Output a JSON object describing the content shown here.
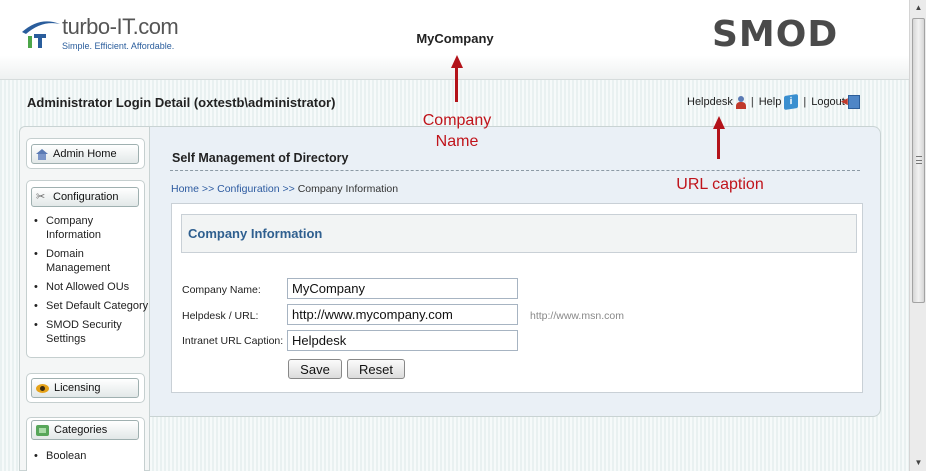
{
  "header": {
    "brand_name": "turbo-IT.com",
    "brand_tagline": "Simple. Efficient. Affordable.",
    "company_title": "MyCompany",
    "right_logo": "SMOD"
  },
  "subheader": {
    "admin_title": "Administrator Login Detail (oxtestb\\administrator)",
    "links": {
      "helpdesk": "Helpdesk",
      "help": "Help",
      "logout": "Logout",
      "separator": "|"
    }
  },
  "sidebar": {
    "admin_home": "Admin Home",
    "configuration": {
      "label": "Configuration",
      "items": [
        "Company Information",
        "Domain Management",
        "Not Allowed OUs",
        "Set Default Category",
        "SMOD Security Settings"
      ]
    },
    "licensing": "Licensing",
    "categories": {
      "label": "Categories",
      "items": [
        "Boolean"
      ]
    }
  },
  "main": {
    "title": "Self Management of Directory",
    "breadcrumb": {
      "home": "Home",
      "sep": " >> ",
      "configuration": "Configuration",
      "current": "Company Information"
    },
    "section_title": "Company Information",
    "form": {
      "company_name_label": "Company Name:",
      "company_name_value": "MyCompany",
      "helpdesk_url_label": "Helpdesk / URL:",
      "helpdesk_url_value": "http://www.mycompany.com",
      "helpdesk_url_hint": "http://www.msn.com",
      "intranet_caption_label": "Intranet URL Caption:",
      "intranet_caption_value": "Helpdesk",
      "save_label": "Save",
      "reset_label": "Reset"
    }
  },
  "annotations": {
    "company_name_line1": "Company",
    "company_name_line2": "Name",
    "url_caption": "URL caption",
    "color": "#c0141b"
  }
}
